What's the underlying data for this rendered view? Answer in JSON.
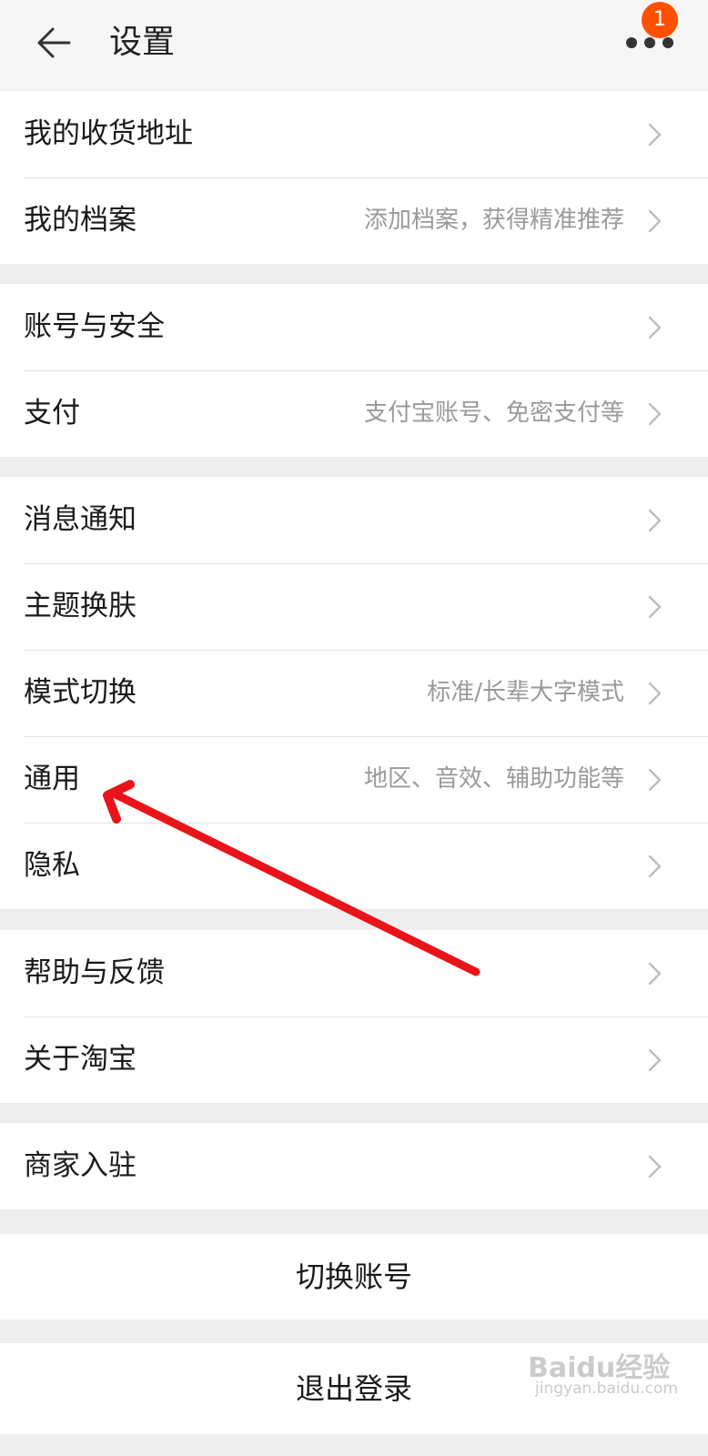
{
  "header": {
    "title": "设置",
    "notification_count": "1"
  },
  "groups": [
    [
      {
        "label": "我的收货地址",
        "hint": ""
      },
      {
        "label": "我的档案",
        "hint": "添加档案，获得精准推荐"
      }
    ],
    [
      {
        "label": "账号与安全",
        "hint": ""
      },
      {
        "label": "支付",
        "hint": "支付宝账号、免密支付等"
      }
    ],
    [
      {
        "label": "消息通知",
        "hint": ""
      },
      {
        "label": "主题换肤",
        "hint": ""
      },
      {
        "label": "模式切换",
        "hint": "标准/长辈大字模式"
      },
      {
        "label": "通用",
        "hint": "地区、音效、辅助功能等"
      },
      {
        "label": "隐私",
        "hint": ""
      }
    ],
    [
      {
        "label": "帮助与反馈",
        "hint": ""
      },
      {
        "label": "关于淘宝",
        "hint": ""
      }
    ],
    [
      {
        "label": "商家入驻",
        "hint": ""
      }
    ]
  ],
  "actions": {
    "switch_account": "切换账号",
    "logout": "退出登录"
  },
  "watermark": {
    "brand": "Baidu经验",
    "url": "jingyan.baidu.com"
  },
  "annotation": {
    "arrow_color": "#e8141a"
  },
  "colors": {
    "accent": "#ff5000"
  },
  "icons": {
    "back": "arrow-left-icon",
    "more": "more-dots-icon",
    "chevron": "chevron-right-icon"
  }
}
